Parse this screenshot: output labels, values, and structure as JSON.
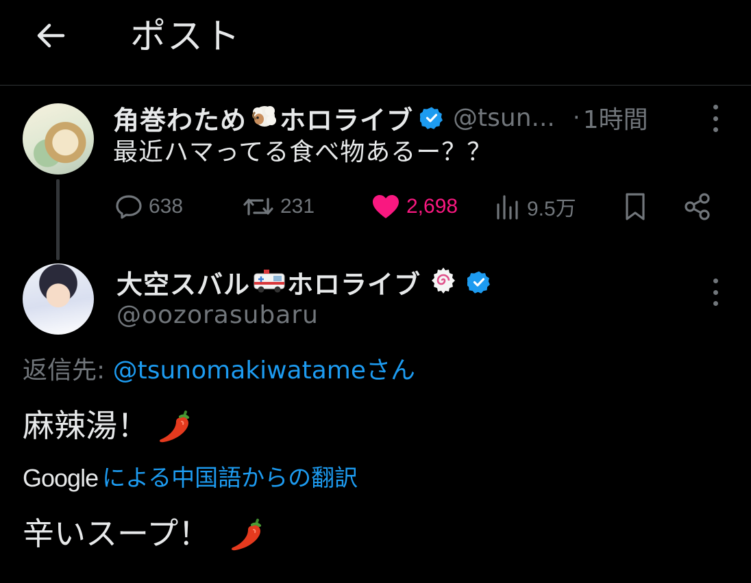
{
  "header": {
    "back_icon": "arrow-left-icon",
    "title": "ポスト"
  },
  "parent_post": {
    "display_name": "角巻わため",
    "name_suffix": "ホロライブ",
    "name_emoji": "sheep-emoji",
    "verified": true,
    "handle_truncated": "@tsun...",
    "separator": "·",
    "time": "1時間",
    "text": "最近ハマってる食べ物あるー？？",
    "stats": {
      "replies": "638",
      "reposts": "231",
      "likes": "2,698",
      "views": "9.5万"
    },
    "liked": true
  },
  "reply_post": {
    "display_name": "大空スバル",
    "name_suffix": "ホロライブ",
    "name_emoji": "ambulance-emoji",
    "extra_emoji": "naruto-fishcake-emoji",
    "verified": true,
    "handle": "@oozorasubaru",
    "reply_to_label": "返信先:",
    "reply_to_mention": "@tsunomakiwatameさん",
    "text": "麻辣湯！",
    "text_emoji": "hot-pepper-emoji",
    "translate_brand": "Google",
    "translate_label": "による中国語からの翻訳",
    "translated_text": "辛いスープ！",
    "translated_emoji": "hot-pepper-emoji"
  },
  "colors": {
    "background": "#000000",
    "text": "#e7e9ea",
    "secondary_text": "#71767b",
    "link": "#1d9bf0",
    "like": "#f91880",
    "verified": "#1d9bf0",
    "divider": "#2f3336"
  }
}
